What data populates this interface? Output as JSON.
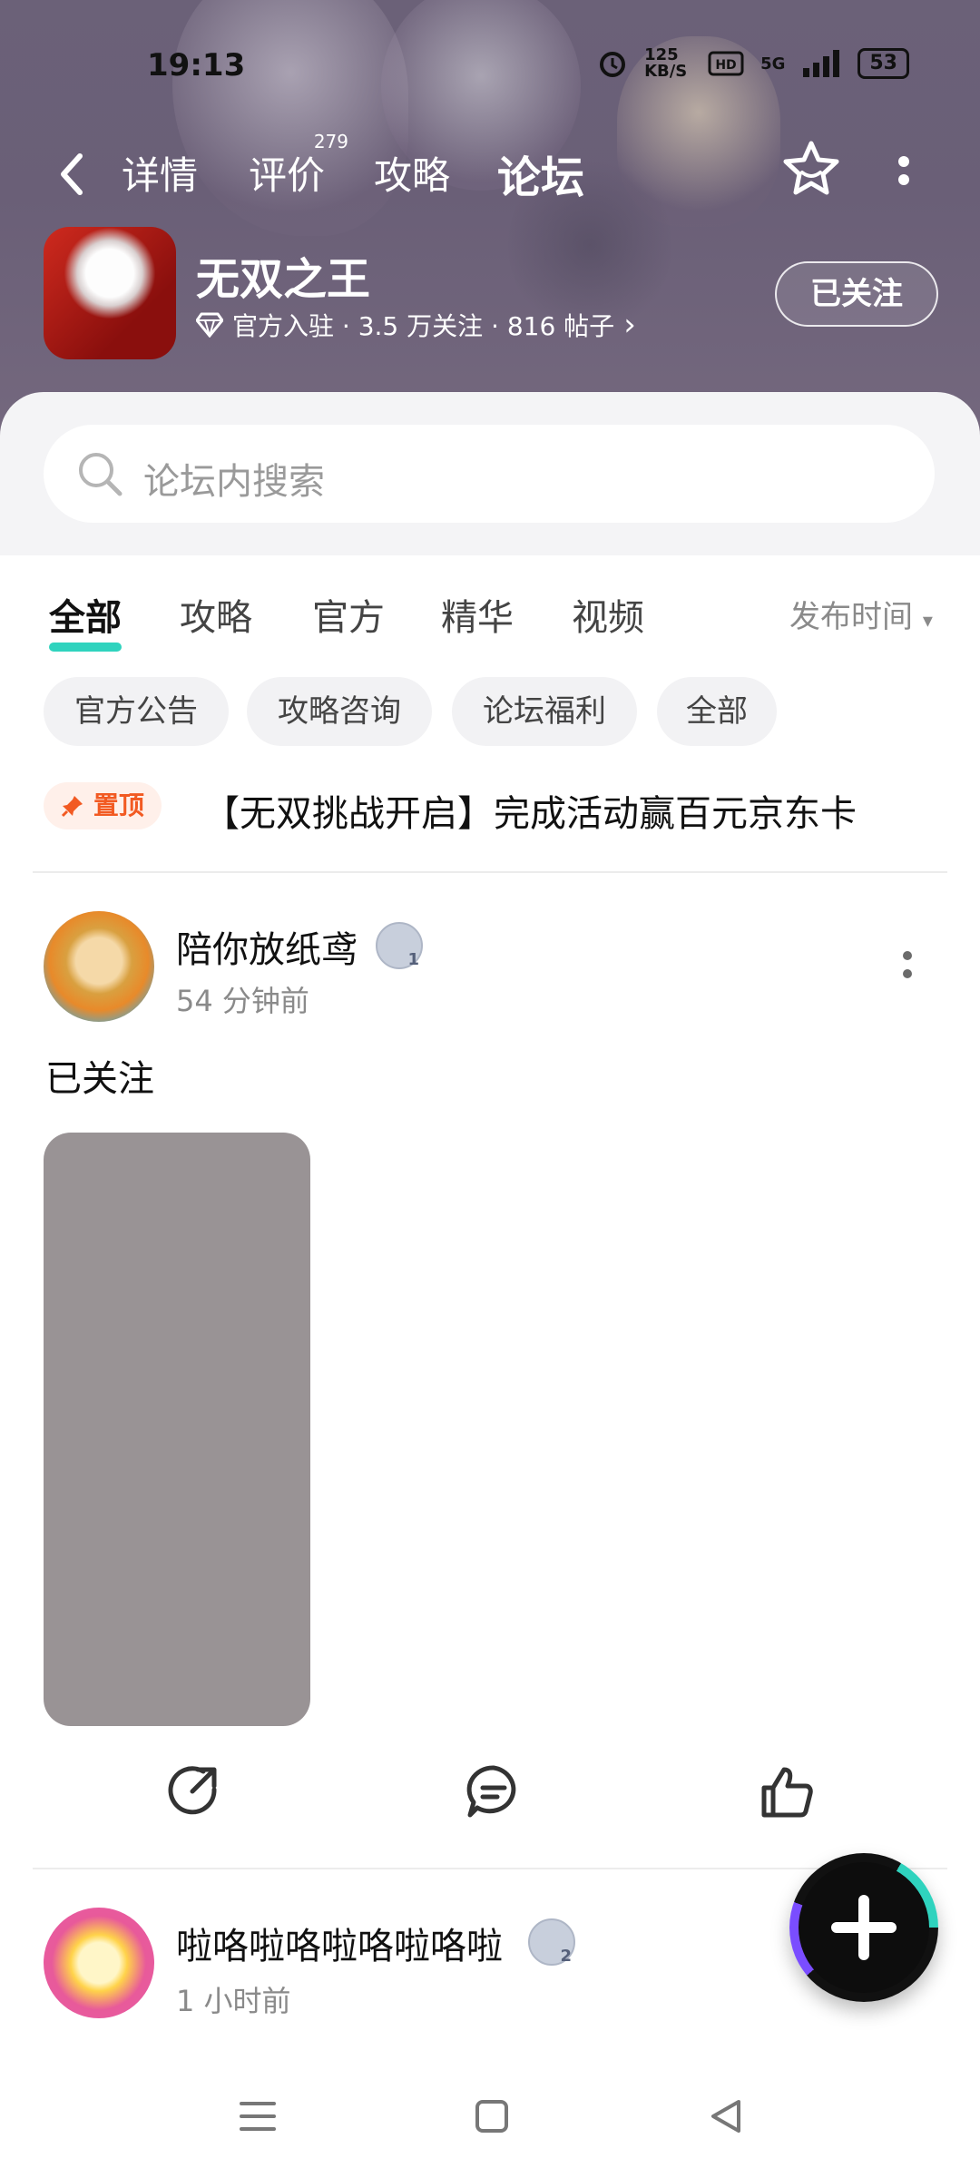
{
  "status_bar": {
    "time": "19:13",
    "net_speed": "125 KB/S",
    "network": "5G",
    "battery": "53"
  },
  "header": {
    "tabs": [
      {
        "label": "详情"
      },
      {
        "label": "评价",
        "badge": "279"
      },
      {
        "label": "攻略"
      },
      {
        "label": "论坛"
      }
    ],
    "active_tab": "论坛"
  },
  "app": {
    "name": "无双之王",
    "meta": "官方入驻 · 3.5 万关注 · 816 帖子",
    "meta_chevron": "›",
    "follow_label": "已关注"
  },
  "search": {
    "placeholder": "论坛内搜索"
  },
  "filter_tabs": {
    "items": [
      "全部",
      "攻略",
      "官方",
      "精华",
      "视频"
    ],
    "active": "全部",
    "sort_label": "发布时间",
    "sort_arrow": "▾"
  },
  "chips": [
    "官方公告",
    "攻略咨询",
    "论坛福利",
    "全部"
  ],
  "pinned": {
    "badge": "置顶",
    "text": "【无双挑战开启】完成活动赢百元京东卡"
  },
  "posts": [
    {
      "author": "陪你放纸鸢",
      "level": "1",
      "time": "54 分钟前",
      "text": "已关注"
    },
    {
      "author": "啦咯啦咯啦咯啦咯啦",
      "level": "2",
      "time": "1 小时前"
    }
  ],
  "icons": {
    "back": "back-icon",
    "star": "star-icon",
    "more": "more-icon",
    "search": "search-icon",
    "share": "share-icon",
    "comment": "comment-icon",
    "like": "like-icon",
    "add": "add-icon"
  },
  "colors": {
    "accent": "#2fd3be",
    "pin": "#f25a22"
  }
}
